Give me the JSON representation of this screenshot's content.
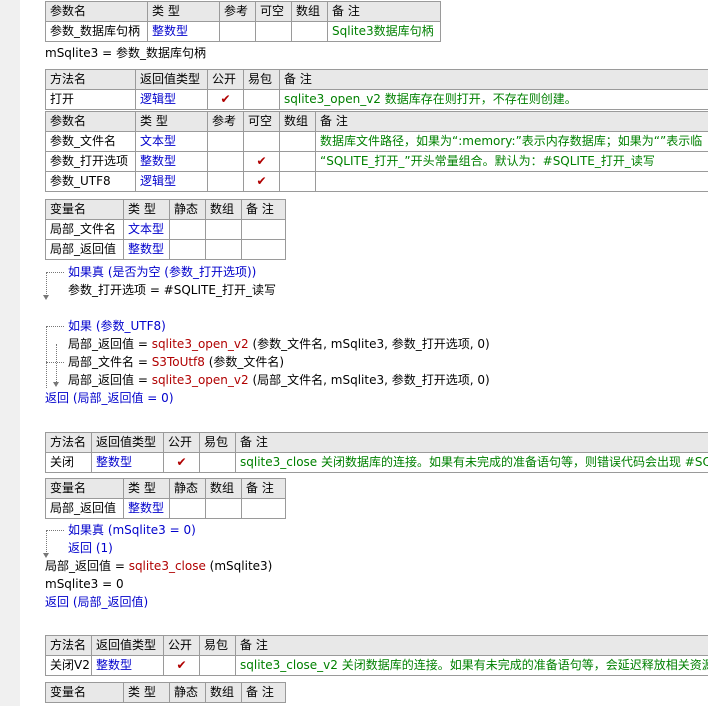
{
  "param_table_top": {
    "headers": [
      "参数名",
      "类 型",
      "参考",
      "可空",
      "数组",
      "备 注"
    ],
    "row": {
      "name": "参数_数据库句柄",
      "type": "整数型",
      "note": "Sqlite3数据库句柄"
    }
  },
  "assign1": "mSqlite3 = 参数_数据库句柄",
  "open_method": {
    "headers": [
      "方法名",
      "返回值类型",
      "公开",
      "易包",
      "备 注"
    ],
    "row": {
      "name": "打开",
      "ret": "逻辑型",
      "public": "✔",
      "note": "sqlite3_open_v2 数据库存在则打开，不存在则创建。"
    },
    "param_headers": [
      "参数名",
      "类 型",
      "参考",
      "可空",
      "数组",
      "备 注"
    ],
    "params": [
      {
        "name": "参数_文件名",
        "type": "文本型",
        "nullable": "",
        "note": "数据库文件路径，如果为“:memory:”表示内存数据库；如果为“”表示临"
      },
      {
        "name": "参数_打开选项",
        "type": "整数型",
        "nullable": "✔",
        "note": "“SQLITE_打开_”开头常量组合。默认为：#SQLITE_打开_读写"
      },
      {
        "name": "参数_UTF8",
        "type": "逻辑型",
        "nullable": "✔",
        "note": ""
      }
    ],
    "var_headers": [
      "变量名",
      "类 型",
      "静态",
      "数组",
      "备 注"
    ],
    "vars": [
      {
        "name": "局部_文件名",
        "type": "文本型"
      },
      {
        "name": "局部_返回值",
        "type": "整数型"
      }
    ],
    "code": {
      "l1": "如果真 (是否为空 (参数_打开选项))",
      "l2": "参数_打开选项 = #SQLITE_打开_读写",
      "l3": "如果 (参数_UTF8)",
      "l4a": "局部_返回值 = ",
      "l4b": "sqlite3_open_v2",
      "l4c": " (参数_文件名, mSqlite3, 参数_打开选项, 0)",
      "l5a": "局部_文件名 = ",
      "l5b": "S3ToUtf8",
      "l5c": " (参数_文件名)",
      "l6a": "局部_返回值 = ",
      "l6b": "sqlite3_open_v2",
      "l6c": " (局部_文件名, mSqlite3, 参数_打开选项, 0)",
      "l7": "返回 (局部_返回值 = 0)"
    }
  },
  "close_method": {
    "headers": [
      "方法名",
      "返回值类型",
      "公开",
      "易包",
      "备 注"
    ],
    "row": {
      "name": "关闭",
      "ret": "整数型",
      "public": "✔",
      "note": "sqlite3_close 关闭数据库的连接。如果有未完成的准备语句等，则错误代码会出现 #SQ"
    },
    "var_headers": [
      "变量名",
      "类 型",
      "静态",
      "数组",
      "备 注"
    ],
    "vars": [
      {
        "name": "局部_返回值",
        "type": "整数型"
      }
    ],
    "code": {
      "l1": "如果真 (mSqlite3 = 0)",
      "l2": "返回 (1)",
      "l3a": "局部_返回值 = ",
      "l3b": "sqlite3_close",
      "l3c": " (mSqlite3)",
      "l4": "mSqlite3 = 0",
      "l5": "返回 (局部_返回值)"
    }
  },
  "close_v2_method": {
    "headers": [
      "方法名",
      "返回值类型",
      "公开",
      "易包",
      "备 注"
    ],
    "row": {
      "name": "关闭V2",
      "ret": "整数型",
      "public": "✔",
      "note": "sqlite3_close_v2 关闭数据库的连接。如果有未完成的准备语句等，会延迟释放相关资源"
    },
    "var_headers": [
      "变量名",
      "类 型",
      "静态",
      "数组",
      "备 注"
    ]
  }
}
